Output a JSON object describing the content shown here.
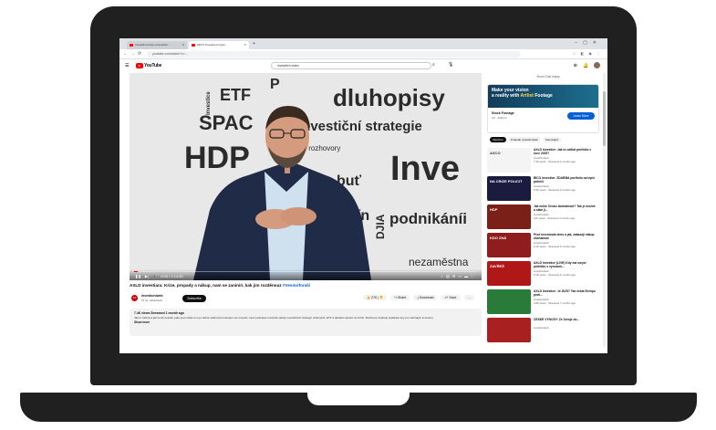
{
  "browser": {
    "tabs": [
      {
        "label": "Investiční fondy | Investiční..."
      },
      {
        "label": "ZETO Investice Kryptor..."
      }
    ],
    "url": "youtube.com/watch?v=..."
  },
  "youtube": {
    "logo_text": "YouTube",
    "search_value": "investiční video"
  },
  "video": {
    "wall_words": [
      "ETF",
      "dluhopisy",
      "investiční strategie",
      "SPAC",
      "HDP",
      "živí rozhovory",
      "Inve",
      "buť",
      "kín",
      "podnikáníi",
      "nezaměstna",
      "investice",
      "DJIA",
      "P"
    ],
    "time": "0:05 / 1:14:50",
    "progress": 0.01,
    "accent_color": "#ff0000"
  },
  "video_title": {
    "text": "AXLD investiara: Krize, propady a nákup, nam se zaniniri, kak jim rozděnouz",
    "hashtag": "#Vesmirfondii"
  },
  "channel": {
    "avatar_text": "AX",
    "name": "investicniweb",
    "subs": "37 tis. odběratelů",
    "subscribe_label": "Subscribe"
  },
  "actions": {
    "like": "276",
    "share": "Share",
    "download": "Download",
    "save": "Save",
    "more": "…"
  },
  "description": {
    "meta": "7.4K views  Streamed 1 month ago",
    "text": "Jak to začíná a jak končí pravdě, jaké jsou rizika a co je dobré vědět před vstupem do investic. Host podcastu rozebírá otázky investičních strategií, dluhopisů, ETF a aktuální situaci na trzích. Rozhovor doplňují praktické tipy pro začínající investory.",
    "more": "Show more"
  },
  "sidebar": {
    "label": "Show Chat replay",
    "ad": {
      "line1": "Make your vision",
      "line2_prefix": "a reality with ",
      "line2_highlight": "Artlist",
      "line2_suffix": " Footage",
      "brand": "Stock Footage",
      "sub": "Ad · artlist.io",
      "button": "Learn More"
    },
    "chips": [
      "Všechno",
      "Z kanálu investicniweb",
      "Související"
    ],
    "recs": [
      {
        "title": "AXLD Investice: Jak to udělat portfolio v roce 2025?",
        "chan": "investicniweb",
        "meta": "7.3K views · Streamed 2 months ago",
        "thumb_text": "AXCO",
        "thumb_bg": "#f4f4f4",
        "thumb_fg": "#333333"
      },
      {
        "title": "BÍCO Investice: ZDARMA portfolio na lepší průměr",
        "chan": "investicniweb",
        "meta": "5.3K views · Streamed 3 months ago",
        "thumb_text": "NA CRIZE POLICIT",
        "thumb_bg": "#1b1b40",
        "thumb_fg": "#ffffff"
      },
      {
        "title": "Jak může Česko zbohatnout? Tak je možné a stále ji...",
        "chan": "investicniweb",
        "meta": "12K views · Streamed 4 months ago",
        "thumb_text": "HDP",
        "thumb_bg": "#7a2018",
        "thumb_fg": "#ffffff"
      },
      {
        "title": "Proč investovat dnes a jak, zakazuji nákup zbohatnutí",
        "chan": "investicniweb",
        "meta": "9.1K views · Streamed 5 months ago",
        "thumb_text": "KDO ZNÁ",
        "thumb_bg": "#8f1d1d",
        "thumb_fg": "#ffffff"
      },
      {
        "title": "AXLD Investice (LIVE) Kdy má smysl portfolio s výnosem...",
        "chan": "investicniweb",
        "meta": "6.2K views · Streamed 6 months ago",
        "thumb_text": "ZAVŘEŠ",
        "thumb_bg": "#b01818",
        "thumb_fg": "#ffffff"
      },
      {
        "title": "AXLD Investice: Je 2025? Tak čekat Evropu proti...",
        "chan": "investicniweb",
        "meta": "4.8K views · Streamed 7 months ago",
        "thumb_text": "",
        "thumb_bg": "#2a7a3a",
        "thumb_fg": "#ffffff"
      },
      {
        "title": "ČESKÉ VÝNOSY: Ze Zdroje do...",
        "chan": "investicniweb",
        "meta": "",
        "thumb_text": "",
        "thumb_bg": "#a82020",
        "thumb_fg": "#ffffff"
      }
    ]
  }
}
